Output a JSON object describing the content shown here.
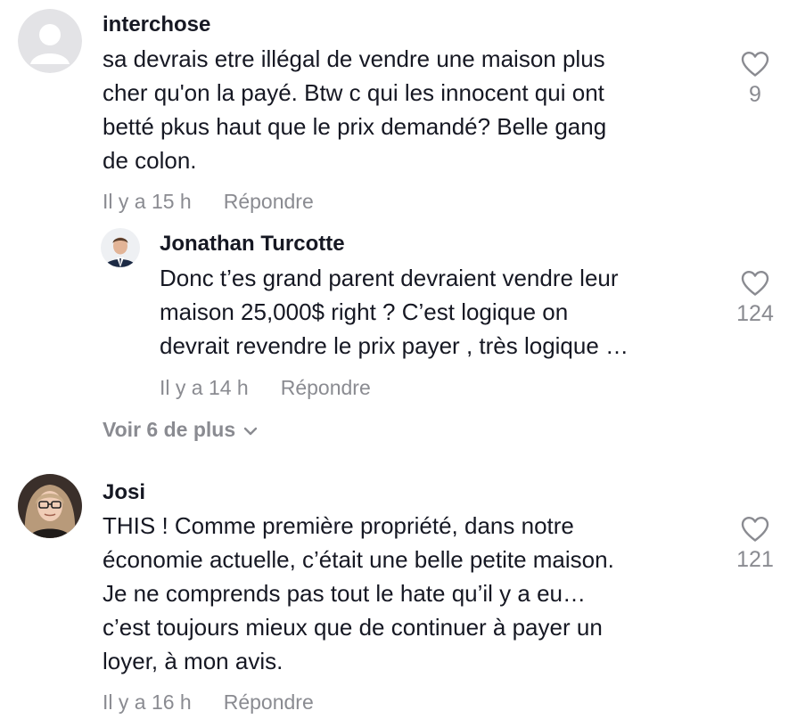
{
  "comments": [
    {
      "username": "interchose",
      "text": "sa devrais etre illégal de vendre une maison plus\ncher qu'on la payé. Btw c qui les innocent qui ont\nbetté pkus haut que le prix demandé? Belle gang\nde colon.",
      "time": "Il y a 15 h",
      "reply_label": "Répondre",
      "likes": "9",
      "avatar_icon": "default-avatar-icon"
    },
    {
      "username": "Jonathan Turcotte",
      "text": "Donc t’es grand parent devraient vendre leur\nmaison 25,000$ right ? C’est logique on\ndevrait revendre le prix payer , très logique …",
      "time": "Il y a 14 h",
      "reply_label": "Répondre",
      "likes": "124",
      "avatar_icon": "profile-photo"
    },
    {
      "username": "Josi",
      "text": "THIS ! Comme première propriété, dans notre\néconomie actuelle, c’était une belle petite maison.\nJe ne comprends pas tout le hate qu’il y a eu…\nc’est toujours mieux que de continuer à payer un\nloyer, à mon avis.",
      "time": "Il y a 16 h",
      "reply_label": "Répondre",
      "likes": "121",
      "avatar_icon": "profile-photo"
    }
  ],
  "view_more": {
    "label": "Voir 6 de plus",
    "icon": "chevron-down-icon"
  },
  "colors": {
    "text": "#161823",
    "muted": "#8a8b91",
    "heart_stroke": "#8a8b91",
    "avatar_default_bg": "#e3e3e6"
  }
}
